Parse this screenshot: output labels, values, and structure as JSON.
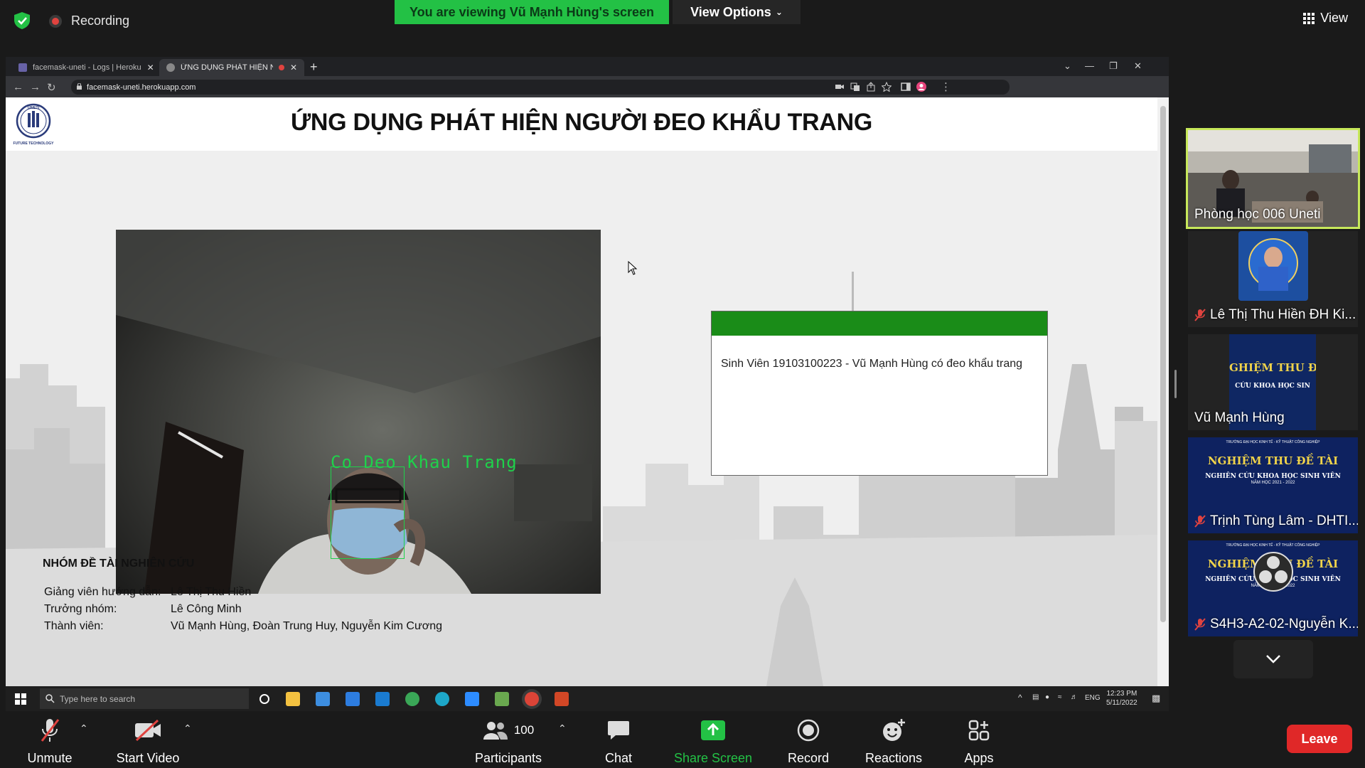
{
  "zoom": {
    "recording_label": "Recording",
    "viewing_banner": "You are viewing Vũ Mạnh Hùng's screen",
    "view_options_label": "View Options",
    "view_label": "View"
  },
  "browser": {
    "tabs": [
      {
        "title": "facemask-uneti - Logs | Heroku"
      },
      {
        "title": "ỨNG DỤNG PHÁT HIỆN NGƯ..."
      }
    ],
    "url": "facemask-uneti.herokuapp.com"
  },
  "page": {
    "title": "ỨNG DỤNG PHÁT HIỆN NGƯỜI ĐEO KHẨU TRANG",
    "logo_text_top": "UNETI",
    "logo_text_bottom": "FUTURE TECHNOLOGY",
    "detection_label": "Co Deo Khau Trang",
    "result_text": "Sinh Viên 19103100223 - Vũ Mạnh Hùng có đeo khẩu trang",
    "team": {
      "title": "NHÓM ĐỀ TÀI NGHIÊN CỨU",
      "rows": [
        {
          "label": "Giảng viên hướng dẫn:",
          "value": "Lê Thị Thu Hiền"
        },
        {
          "label": "Trưởng nhóm:",
          "value": "Lê Công Minh"
        },
        {
          "label": "Thành viên:",
          "value": "Vũ Mạnh Hùng, Đoàn Trung Huy, Nguyễn Kim Cương"
        }
      ]
    },
    "accent_color": "#1a8c18"
  },
  "taskbar": {
    "search_placeholder": "Type here to search",
    "lang": "ENG",
    "time": "12:23 PM",
    "date": "5/11/2022"
  },
  "participants_panel": {
    "tiles": [
      {
        "name": "Phòng học 006 Uneti",
        "muted": false
      },
      {
        "name": "Lê Thị Thu Hiền ĐH Ki...",
        "muted": true
      },
      {
        "name": "Vũ Mạnh Hùng",
        "muted": false
      },
      {
        "name": "Trịnh Tùng Lâm - DHTI...",
        "muted": true
      },
      {
        "name": "S4H3-A2-02-Nguyễn K...",
        "muted": true
      }
    ],
    "banner_text_line1": "NGHIỆM THU ĐỀ TÀI",
    "banner_text_line2": "NGHIÊN CỨU KHOA HỌC SINH VIÊN",
    "banner_text_year": "NĂM HỌC 2021 - 2022",
    "banner_school": "TRƯỜNG ĐẠI HỌC KINH TẾ - KỸ THUẬT CÔNG NGHIỆP"
  },
  "toolbar": {
    "unmute": "Unmute",
    "start_video": "Start Video",
    "participants": "Participants",
    "participant_count": "100",
    "chat": "Chat",
    "share_screen": "Share Screen",
    "record": "Record",
    "reactions": "Reactions",
    "apps": "Apps",
    "leave": "Leave"
  }
}
